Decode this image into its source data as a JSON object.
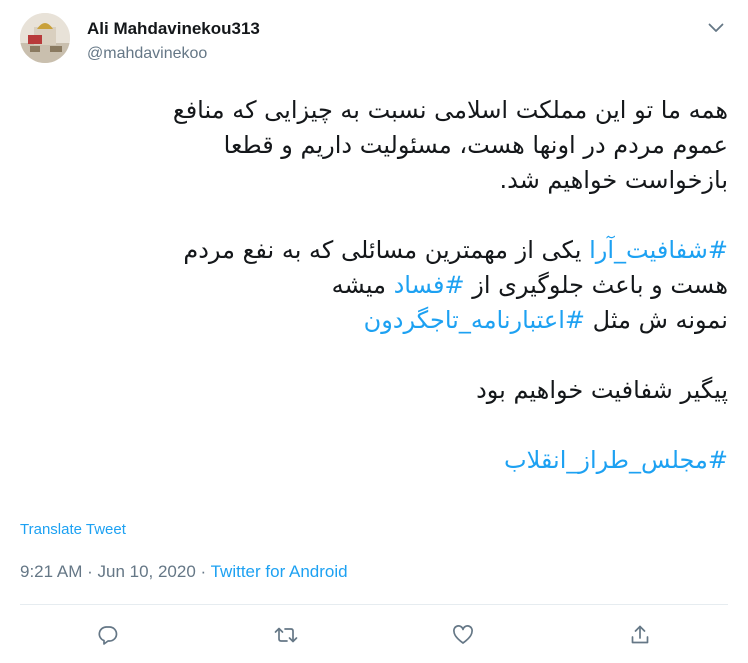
{
  "user": {
    "name": "Ali Mahdavinekou313",
    "handle": "@mahdavinekoo"
  },
  "tweet": {
    "line1": "همه ما تو این مملکت اسلامی نسبت به چیزایی که منافع",
    "line2": "عموم مردم در اونها هست، مسئولیت داریم و قطعا",
    "line3": "بازخواست خواهیم شد.",
    "tag_shafafiat_ara": "#شفافیت_آرا",
    "line4_text": " یکی از مهمترین مسائلی که به نفع مردم",
    "line5_text": "هست و باعث جلوگیری از ",
    "tag_fesad": "#فساد",
    "line5_end": " میشه",
    "line6_text": "نمونه ش مثل ",
    "tag_etebarnameh": "#اعتبارنامه_تاجگردون",
    "line7": "پیگیر شفافیت خواهیم بود",
    "tag_majles": "#مجلس_طراز_انقلاب"
  },
  "translate_label": "Translate Tweet",
  "meta": {
    "time": "9:21 AM",
    "separator1": " · ",
    "date": "Jun 10, 2020",
    "separator2": " · ",
    "source": "Twitter for Android"
  },
  "icons": {
    "menu": "chevron-down-icon",
    "reply": "reply-icon",
    "retweet": "retweet-icon",
    "like": "heart-icon",
    "share": "share-icon"
  },
  "colors": {
    "link": "#1da1f2",
    "muted": "#657786",
    "text": "#14171a"
  }
}
